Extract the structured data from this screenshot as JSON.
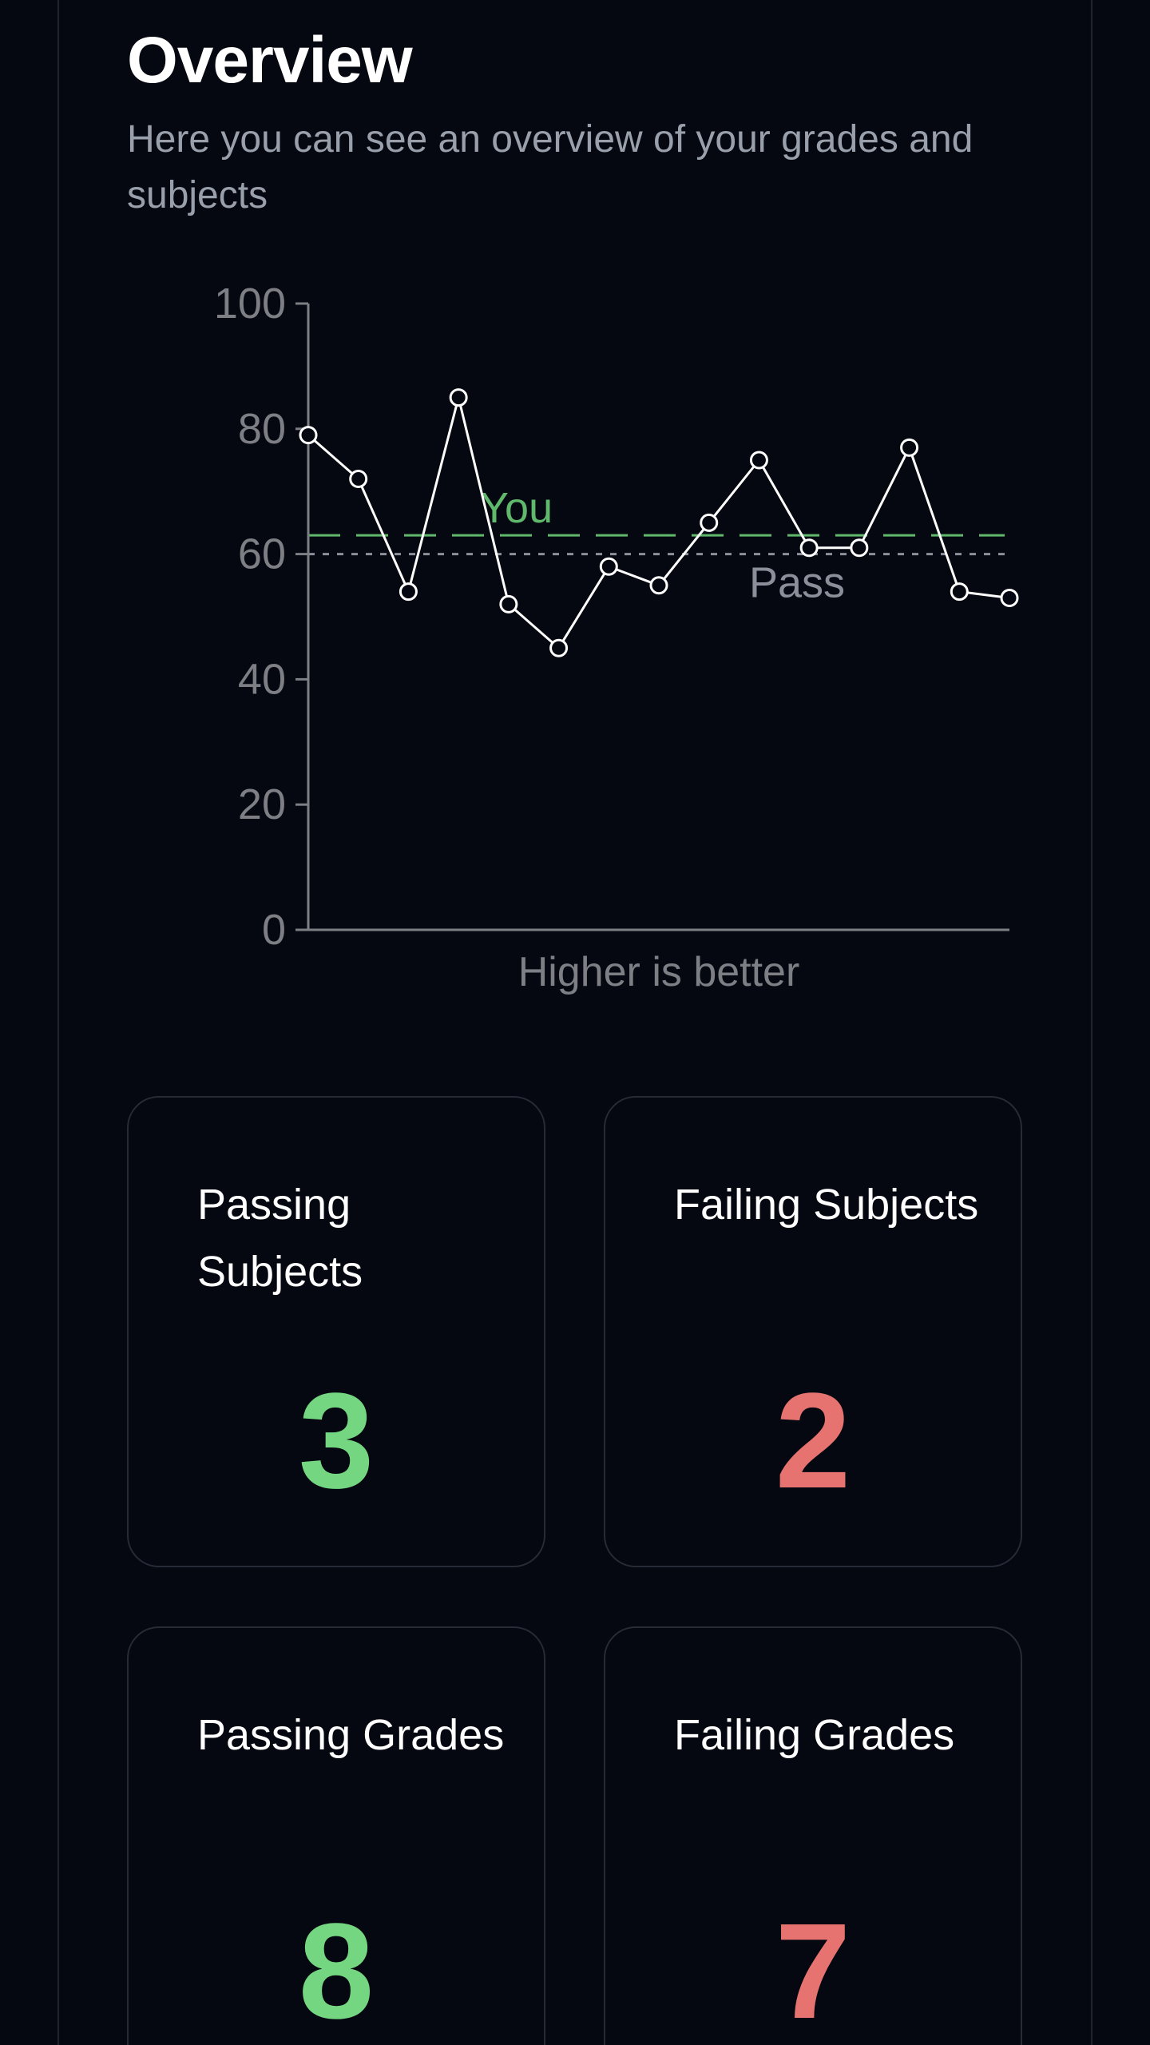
{
  "page": {
    "title": "Overview",
    "subtitle": "Here you can see an overview of your grades and subjects"
  },
  "chart_data": {
    "type": "line",
    "x": [
      1,
      2,
      3,
      4,
      5,
      6,
      7,
      8,
      9,
      10,
      11,
      12,
      13,
      14,
      15
    ],
    "values": [
      79,
      72,
      54,
      85,
      52,
      45,
      58,
      55,
      65,
      75,
      61,
      61,
      77,
      54,
      53
    ],
    "ylim": [
      0,
      100
    ],
    "yticks": [
      0,
      20,
      40,
      60,
      80,
      100
    ],
    "xlabel": "Higher is better",
    "grid": false,
    "reference_lines": [
      {
        "label": "You",
        "value": 63,
        "style": "dashed",
        "color": "#5fb86b"
      },
      {
        "label": "Pass",
        "value": 60,
        "style": "dotted",
        "color": "#8a8f99"
      }
    ],
    "colors": {
      "line": "#ffffff",
      "axis": "#7d7f85",
      "tick_text": "#7d7f85"
    }
  },
  "stats": {
    "passing_subjects": {
      "label": "Passing Subjects",
      "value": "3"
    },
    "failing_subjects": {
      "label": "Failing Subjects",
      "value": "2"
    },
    "passing_grades": {
      "label": "Passing Grades",
      "value": "8"
    },
    "failing_grades": {
      "label": "Failing Grades",
      "value": "7"
    }
  },
  "colors": {
    "background": "#050811",
    "positive": "#74d680",
    "negative": "#e6736f",
    "muted_text": "#9aa0ab"
  }
}
